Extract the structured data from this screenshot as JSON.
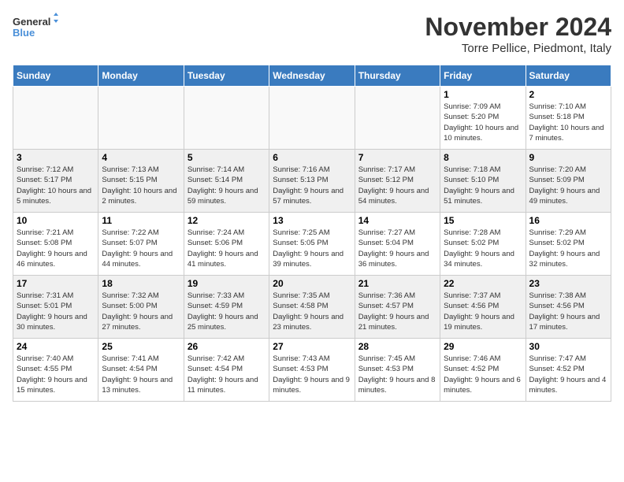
{
  "header": {
    "logo_line1": "General",
    "logo_line2": "Blue",
    "month": "November 2024",
    "location": "Torre Pellice, Piedmont, Italy"
  },
  "weekdays": [
    "Sunday",
    "Monday",
    "Tuesday",
    "Wednesday",
    "Thursday",
    "Friday",
    "Saturday"
  ],
  "weeks": [
    [
      {
        "day": "",
        "info": ""
      },
      {
        "day": "",
        "info": ""
      },
      {
        "day": "",
        "info": ""
      },
      {
        "day": "",
        "info": ""
      },
      {
        "day": "",
        "info": ""
      },
      {
        "day": "1",
        "info": "Sunrise: 7:09 AM\nSunset: 5:20 PM\nDaylight: 10 hours and 10 minutes."
      },
      {
        "day": "2",
        "info": "Sunrise: 7:10 AM\nSunset: 5:18 PM\nDaylight: 10 hours and 7 minutes."
      }
    ],
    [
      {
        "day": "3",
        "info": "Sunrise: 7:12 AM\nSunset: 5:17 PM\nDaylight: 10 hours and 5 minutes."
      },
      {
        "day": "4",
        "info": "Sunrise: 7:13 AM\nSunset: 5:15 PM\nDaylight: 10 hours and 2 minutes."
      },
      {
        "day": "5",
        "info": "Sunrise: 7:14 AM\nSunset: 5:14 PM\nDaylight: 9 hours and 59 minutes."
      },
      {
        "day": "6",
        "info": "Sunrise: 7:16 AM\nSunset: 5:13 PM\nDaylight: 9 hours and 57 minutes."
      },
      {
        "day": "7",
        "info": "Sunrise: 7:17 AM\nSunset: 5:12 PM\nDaylight: 9 hours and 54 minutes."
      },
      {
        "day": "8",
        "info": "Sunrise: 7:18 AM\nSunset: 5:10 PM\nDaylight: 9 hours and 51 minutes."
      },
      {
        "day": "9",
        "info": "Sunrise: 7:20 AM\nSunset: 5:09 PM\nDaylight: 9 hours and 49 minutes."
      }
    ],
    [
      {
        "day": "10",
        "info": "Sunrise: 7:21 AM\nSunset: 5:08 PM\nDaylight: 9 hours and 46 minutes."
      },
      {
        "day": "11",
        "info": "Sunrise: 7:22 AM\nSunset: 5:07 PM\nDaylight: 9 hours and 44 minutes."
      },
      {
        "day": "12",
        "info": "Sunrise: 7:24 AM\nSunset: 5:06 PM\nDaylight: 9 hours and 41 minutes."
      },
      {
        "day": "13",
        "info": "Sunrise: 7:25 AM\nSunset: 5:05 PM\nDaylight: 9 hours and 39 minutes."
      },
      {
        "day": "14",
        "info": "Sunrise: 7:27 AM\nSunset: 5:04 PM\nDaylight: 9 hours and 36 minutes."
      },
      {
        "day": "15",
        "info": "Sunrise: 7:28 AM\nSunset: 5:02 PM\nDaylight: 9 hours and 34 minutes."
      },
      {
        "day": "16",
        "info": "Sunrise: 7:29 AM\nSunset: 5:02 PM\nDaylight: 9 hours and 32 minutes."
      }
    ],
    [
      {
        "day": "17",
        "info": "Sunrise: 7:31 AM\nSunset: 5:01 PM\nDaylight: 9 hours and 30 minutes."
      },
      {
        "day": "18",
        "info": "Sunrise: 7:32 AM\nSunset: 5:00 PM\nDaylight: 9 hours and 27 minutes."
      },
      {
        "day": "19",
        "info": "Sunrise: 7:33 AM\nSunset: 4:59 PM\nDaylight: 9 hours and 25 minutes."
      },
      {
        "day": "20",
        "info": "Sunrise: 7:35 AM\nSunset: 4:58 PM\nDaylight: 9 hours and 23 minutes."
      },
      {
        "day": "21",
        "info": "Sunrise: 7:36 AM\nSunset: 4:57 PM\nDaylight: 9 hours and 21 minutes."
      },
      {
        "day": "22",
        "info": "Sunrise: 7:37 AM\nSunset: 4:56 PM\nDaylight: 9 hours and 19 minutes."
      },
      {
        "day": "23",
        "info": "Sunrise: 7:38 AM\nSunset: 4:56 PM\nDaylight: 9 hours and 17 minutes."
      }
    ],
    [
      {
        "day": "24",
        "info": "Sunrise: 7:40 AM\nSunset: 4:55 PM\nDaylight: 9 hours and 15 minutes."
      },
      {
        "day": "25",
        "info": "Sunrise: 7:41 AM\nSunset: 4:54 PM\nDaylight: 9 hours and 13 minutes."
      },
      {
        "day": "26",
        "info": "Sunrise: 7:42 AM\nSunset: 4:54 PM\nDaylight: 9 hours and 11 minutes."
      },
      {
        "day": "27",
        "info": "Sunrise: 7:43 AM\nSunset: 4:53 PM\nDaylight: 9 hours and 9 minutes."
      },
      {
        "day": "28",
        "info": "Sunrise: 7:45 AM\nSunset: 4:53 PM\nDaylight: 9 hours and 8 minutes."
      },
      {
        "day": "29",
        "info": "Sunrise: 7:46 AM\nSunset: 4:52 PM\nDaylight: 9 hours and 6 minutes."
      },
      {
        "day": "30",
        "info": "Sunrise: 7:47 AM\nSunset: 4:52 PM\nDaylight: 9 hours and 4 minutes."
      }
    ]
  ]
}
